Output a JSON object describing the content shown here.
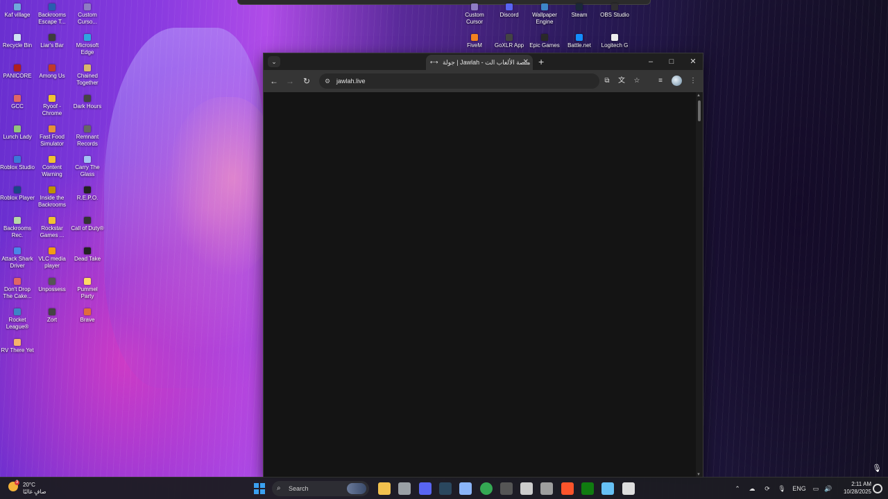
{
  "desktop": {
    "icons": [
      {
        "label": "Kaf village",
        "color": "#6fa8dc"
      },
      {
        "label": "Backrooms Escape T...",
        "color": "#2a5db0"
      },
      {
        "label": "Custom Curso...",
        "color": "#8e7cc3"
      },
      {
        "label": "Recycle Bin",
        "color": "#cfe2f3"
      },
      {
        "label": "Liar's Bar",
        "color": "#3d3d3d"
      },
      {
        "label": "Microsoft Edge",
        "color": "#2fa5e0"
      },
      {
        "label": "PANICORE",
        "color": "#b02020"
      },
      {
        "label": "Among Us",
        "color": "#c0392b"
      },
      {
        "label": "Chained Together",
        "color": "#d9b86c"
      },
      {
        "label": "GCC",
        "color": "#e06666"
      },
      {
        "label": "Ryoof - Chrome",
        "color": "#f1c232"
      },
      {
        "label": "Dark Hours",
        "color": "#444444"
      },
      {
        "label": "Lunch Lady",
        "color": "#93c47d"
      },
      {
        "label": "Fast Food Simulator",
        "color": "#e69138"
      },
      {
        "label": "Remnant Records",
        "color": "#666666"
      },
      {
        "label": "Roblox Studio",
        "color": "#3c78d8"
      },
      {
        "label": "Content Warning",
        "color": "#f1c232"
      },
      {
        "label": "Carry The Glass",
        "color": "#a4c2f4"
      },
      {
        "label": "Roblox Player",
        "color": "#1c4587"
      },
      {
        "label": "Inside the Backrooms",
        "color": "#bf9000"
      },
      {
        "label": "R.E.P.O.",
        "color": "#222222"
      },
      {
        "label": "Backrooms Rec.",
        "color": "#b6d7a8"
      },
      {
        "label": "Rockstar Games ...",
        "color": "#f1c232"
      },
      {
        "label": "Call of Duty®",
        "color": "#333333"
      },
      {
        "label": "Attack Shark Driver",
        "color": "#4a86e8"
      },
      {
        "label": "VLC media player",
        "color": "#f39c12"
      },
      {
        "label": "Dead Take",
        "color": "#222222"
      },
      {
        "label": "Don't Drop The Cake...",
        "color": "#e06666"
      },
      {
        "label": "Unpossess",
        "color": "#555555"
      },
      {
        "label": "Pummel Party",
        "color": "#ffd966"
      },
      {
        "label": "Rocket League®",
        "color": "#3d85c6"
      },
      {
        "label": "Zort",
        "color": "#444444"
      },
      {
        "label": "Brave",
        "color": "#e06c3c"
      },
      {
        "label": "RV There Yet",
        "color": "#f6b26b"
      },
      {
        "label": "Custom Cursor",
        "color": "#8e7cc3"
      },
      {
        "label": "Discord",
        "color": "#5865f2"
      },
      {
        "label": "Wallpaper Engine",
        "color": "#3d85c6"
      },
      {
        "label": "Steam",
        "color": "#1b2838"
      },
      {
        "label": "OBS Studio",
        "color": "#302e31"
      },
      {
        "label": "FiveM",
        "color": "#f58220"
      },
      {
        "label": "GoXLR App",
        "color": "#444444"
      },
      {
        "label": "Epic Games",
        "color": "#2a2a2a"
      },
      {
        "label": "Battle.net",
        "color": "#148eff"
      },
      {
        "label": "Logitech G",
        "color": "#eeeeee"
      }
    ]
  },
  "browser": {
    "tab_title": "جولة | Jawlah - منصة الألعاب الت",
    "tab_favicon": "⟷",
    "new_tab_label": "+",
    "address": "jawlah.live",
    "window_controls": {
      "minimize": "–",
      "maximize": "□",
      "close": "✕"
    }
  },
  "taskbar": {
    "weather_temp": "20°C",
    "weather_desc": "صافٍ غالبًا",
    "weather_badge": "3",
    "search_placeholder": "Search",
    "language": "ENG",
    "time": "2:11 AM",
    "date": "10/28/2025",
    "apps": [
      {
        "name": "file-explorer",
        "color": "#f2c14e"
      },
      {
        "name": "store",
        "color": "#9aa0a6"
      },
      {
        "name": "discord",
        "color": "#5865f2"
      },
      {
        "name": "steam",
        "color": "#2a475e"
      },
      {
        "name": "settings",
        "color": "#8ab4f8"
      },
      {
        "name": "chrome",
        "color": "#34a853"
      },
      {
        "name": "app-dark",
        "color": "#555555"
      },
      {
        "name": "notepad",
        "color": "#cccccc"
      },
      {
        "name": "app-circle",
        "color": "#9e9e9e"
      },
      {
        "name": "brave",
        "color": "#fb542b"
      },
      {
        "name": "xbox",
        "color": "#107c10"
      },
      {
        "name": "steam-2",
        "color": "#66c0f4"
      },
      {
        "name": "loader",
        "color": "#dddddd"
      }
    ]
  }
}
